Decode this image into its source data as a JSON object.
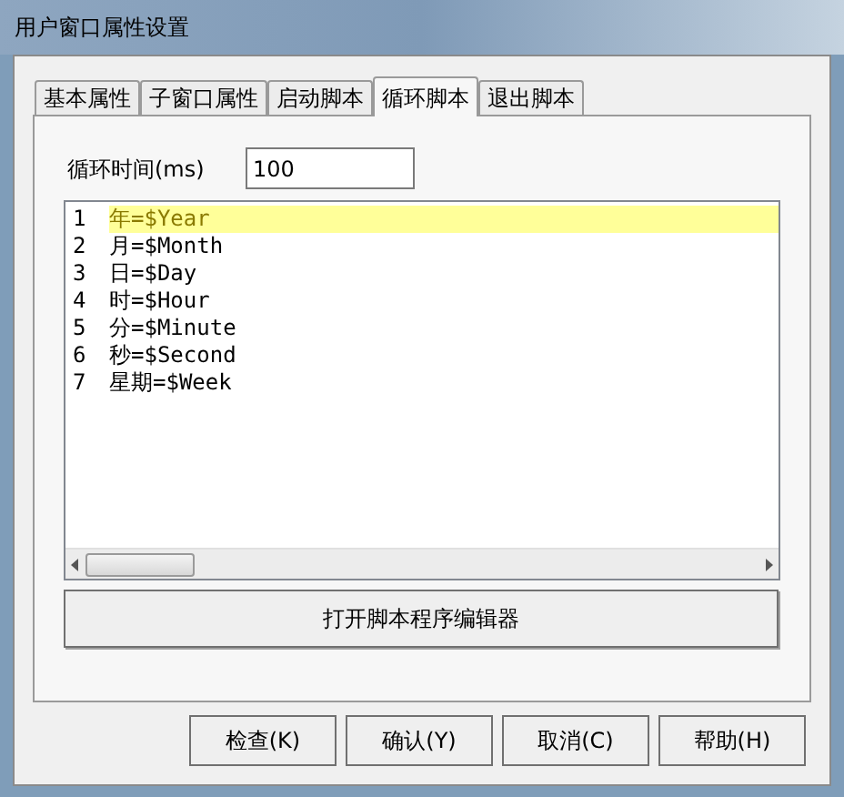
{
  "window": {
    "title": "用户窗口属性设置"
  },
  "tabs": [
    {
      "label": "基本属性",
      "selected": false
    },
    {
      "label": "子窗口属性",
      "selected": false
    },
    {
      "label": "启动脚本",
      "selected": false
    },
    {
      "label": "循环脚本",
      "selected": true
    },
    {
      "label": "退出脚本",
      "selected": false
    }
  ],
  "loop_time": {
    "label": "循环时间(ms)",
    "value": "100"
  },
  "editor": {
    "lines": [
      {
        "number": "1",
        "text": "年=$Year",
        "selected": true
      },
      {
        "number": "2",
        "text": "月=$Month",
        "selected": false
      },
      {
        "number": "3",
        "text": "日=$Day",
        "selected": false
      },
      {
        "number": "4",
        "text": "时=$Hour",
        "selected": false
      },
      {
        "number": "5",
        "text": "分=$Minute",
        "selected": false
      },
      {
        "number": "6",
        "text": "秒=$Second",
        "selected": false
      },
      {
        "number": "7",
        "text": "星期=$Week",
        "selected": false
      }
    ]
  },
  "open_editor_button": "打开脚本程序编辑器",
  "buttons": [
    "检查(K)",
    "确认(Y)",
    "取消(C)",
    "帮助(H)"
  ]
}
